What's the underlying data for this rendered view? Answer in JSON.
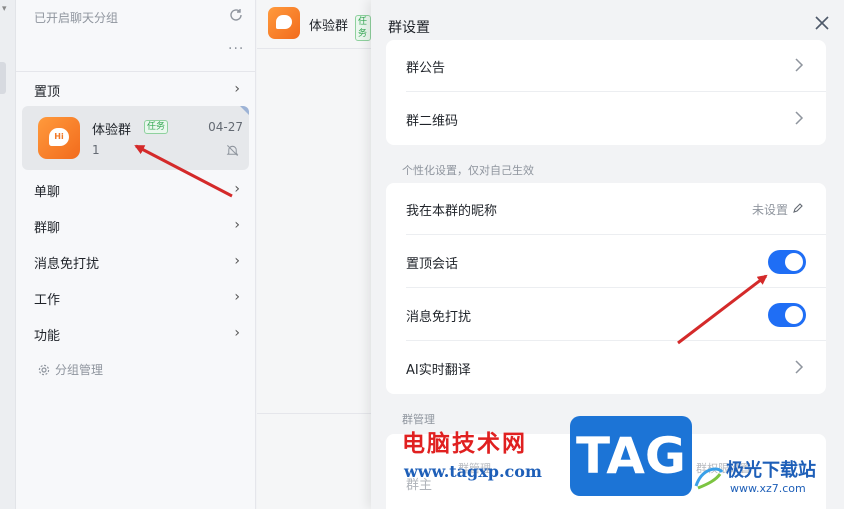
{
  "session_list": {
    "header": "已开启聊天分组",
    "filter_icons": [
      "at-icon",
      "star-icon",
      "clock-icon",
      "doc-icon",
      "file-icon"
    ],
    "more": "···",
    "groups": [
      {
        "label": "置顶"
      },
      {
        "label": "单聊"
      },
      {
        "label": "群聊"
      },
      {
        "label": "消息免打扰"
      },
      {
        "label": "工作"
      },
      {
        "label": "功能"
      }
    ],
    "pinned_chat": {
      "name": "体验群",
      "tag": "任务",
      "time": "04-27",
      "count": "1",
      "avatar_text": "Hi"
    },
    "manage_label": "分组管理"
  },
  "chat": {
    "title": "体验群",
    "tag": "任务"
  },
  "drawer": {
    "title": "群设置",
    "rows_top": [
      {
        "label": "群公告"
      },
      {
        "label": "群二维码"
      }
    ],
    "personal_section": "个性化设置，仅对自己生效",
    "rows_personal": [
      {
        "label": "我在本群的昵称",
        "value": "未设置"
      },
      {
        "label": "置顶会话",
        "toggle": true
      },
      {
        "label": "消息免打扰",
        "toggle": true
      },
      {
        "label": "AI实时翻译"
      }
    ],
    "manage_section": "群管理",
    "manage_row_label": "群主",
    "ghost_left": "群管理",
    "ghost_right": "群权限设置"
  },
  "watermark": {
    "cn": "电脑技术网",
    "url": "www.tagxp.com",
    "tag": "TAG",
    "site_cn": "极光下载站",
    "site_url": "www.xz7.com"
  },
  "colors": {
    "accent": "#1f6ef5",
    "arrow": "#d42a2a",
    "avatar": "#f27a2a"
  }
}
